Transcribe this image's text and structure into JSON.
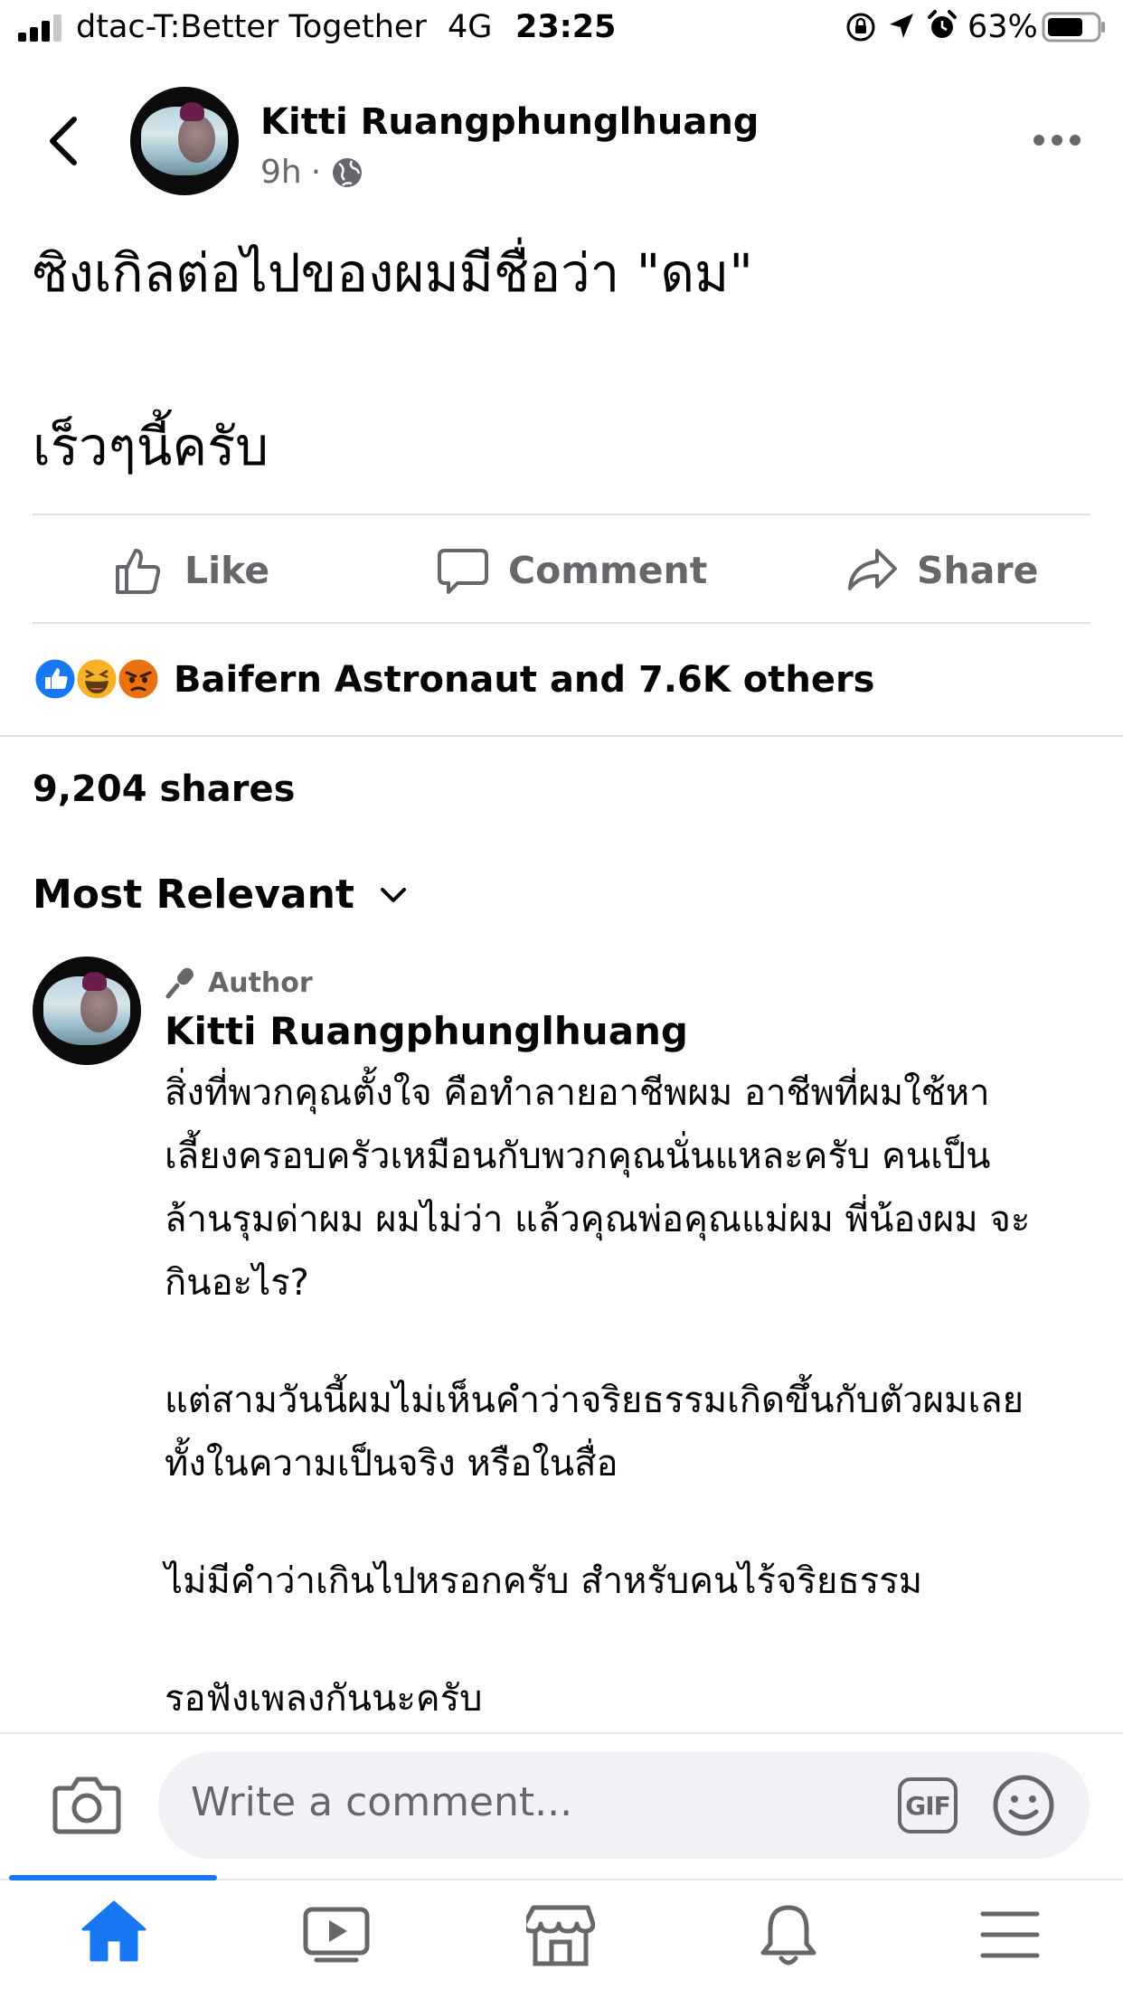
{
  "status_bar": {
    "carrier": "dtac-T:Better Together",
    "network": "4G",
    "time": "23:25",
    "battery": "63%"
  },
  "post": {
    "author": "Kitti Ruangphunglhuang",
    "time": "9h",
    "privacy_icon": "globe-icon",
    "text_line1": "ซิงเกิลต่อไปของผมมีชื่อว่า \"ดม\"",
    "text_line2": "เร็วๆนี้ครับ"
  },
  "actions": {
    "like": "Like",
    "comment": "Comment",
    "share": "Share"
  },
  "reactions": {
    "icons": [
      "like-reaction-icon",
      "haha-reaction-icon",
      "angry-reaction-icon"
    ],
    "summary": "Baifern Astronaut and 7.6K others"
  },
  "shares": "9,204 shares",
  "sort": {
    "label": "Most Relevant"
  },
  "comment": {
    "badge": "Author",
    "author": "Kitti Ruangphunglhuang",
    "lines": [
      "สิ่งที่พวกคุณตั้งใจ คือทำลายอาชีพผม อาชีพที่ผมใช้หา",
      "เลี้ยงครอบครัวเหมือนกับพวกคุณนั่นแหละครับ คนเป็น",
      "ล้านรุมด่าผม ผมไม่ว่า แล้วคุณพ่อคุณแม่ผม พี่น้องผม จะ",
      "กินอะไร?",
      "แต่สามวันนี้ผมไม่เห็นคำว่าจริยธรรมเกิดขึ้นกับตัวผมเลย",
      "ทั้งในความเป็นจริง หรือในสื่อ",
      "ไม่มีคำว่าเกินไปหรอกครับ สำหรับคนไร้จริยธรรม",
      "รอฟังเพลงกันนะครับ"
    ]
  },
  "composer": {
    "placeholder": "Write a comment...",
    "gif_label": "GIF"
  },
  "colors": {
    "accent": "#1877f2",
    "muted_text": "#65676b",
    "divider": "#dddfe2",
    "input_bg": "#f0f2f5"
  }
}
